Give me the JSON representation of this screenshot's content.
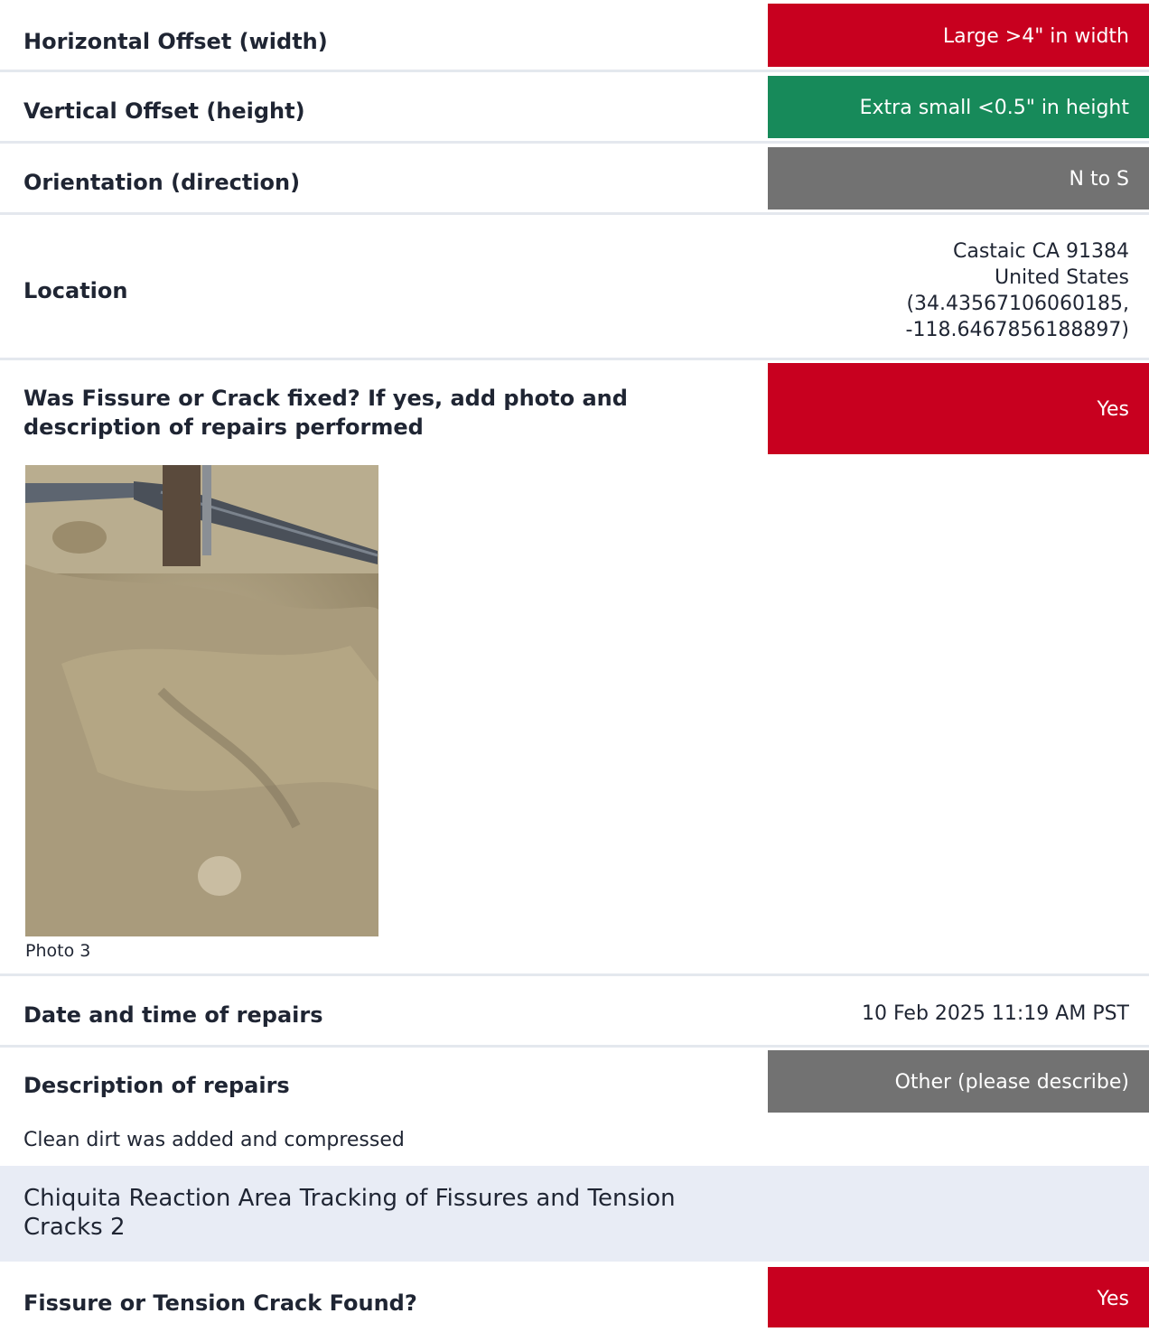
{
  "fields": [
    {
      "label": "Horizontal Offset (width)",
      "value": "Large >4\" in width",
      "color": "#c8001f"
    },
    {
      "label": "Vertical Offset (height)",
      "value": "Extra small <0.5\" in height",
      "color": "#178a5a"
    },
    {
      "label": "Orientation (direction)",
      "value": "N to S",
      "color": "#727272"
    }
  ],
  "location": {
    "label": "Location",
    "lines": [
      "Castaic CA 91384",
      "United States",
      "(34.43567106060185,",
      "-118.6467856188897)"
    ]
  },
  "fixed": {
    "label": "Was Fissure or Crack fixed? If yes, add photo and description of repairs performed",
    "value": "Yes",
    "color": "#c8001f"
  },
  "photo": {
    "caption": "Photo 3"
  },
  "repair_date": {
    "label": "Date and time of repairs",
    "value": "10 Feb 2025 11:19 AM PST"
  },
  "repair_description": {
    "label": "Description of repairs",
    "value": "Other (please describe)",
    "color": "#727272",
    "note": "Clean dirt was added and compressed"
  },
  "section": {
    "title": "Chiquita Reaction Area Tracking of Fissures and Tension Cracks 2"
  },
  "found": {
    "label": "Fissure or Tension Crack Found?",
    "value": "Yes",
    "color": "#c8001f"
  }
}
